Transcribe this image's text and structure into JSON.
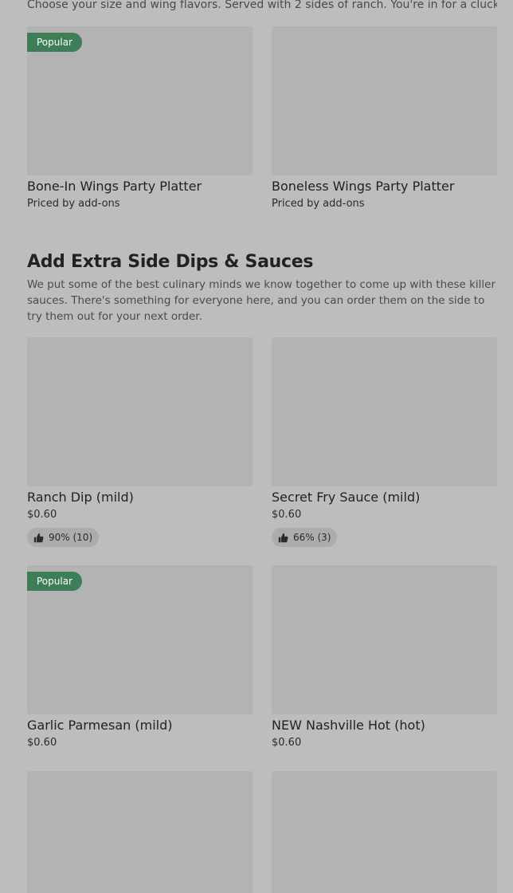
{
  "intro_text": "Choose your size and wing flavors. Served with 2 sides of ranch. You're in for a cluckin' treat!",
  "platters": [
    {
      "name": "Bone-In Wings Party Platter",
      "price": "Priced by add-ons",
      "badge": "Popular"
    },
    {
      "name": "Boneless Wings Party Platter",
      "price": "Priced by add-ons"
    }
  ],
  "section": {
    "title": "Add Extra Side Dips & Sauces",
    "description": "We put some of the best culinary minds we know together to come up with these killer sauces. There's something for everyone here, and you can order them on the side to try them out for your next order."
  },
  "sauces": [
    {
      "name": "Ranch Dip (mild)",
      "price": "$0.60",
      "rating": "90% (10)"
    },
    {
      "name": "Secret Fry Sauce (mild)",
      "price": "$0.60",
      "rating": "66% (3)"
    },
    {
      "name": "Garlic Parmesan (mild)",
      "price": "$0.60",
      "badge": "Popular"
    },
    {
      "name": "NEW Nashville Hot (hot)",
      "price": "$0.60"
    }
  ],
  "icons": {
    "rating": "thumbs-up-icon"
  },
  "colors": {
    "badge_bg": "#3e7e57",
    "placeholder": "#b3b3b3",
    "background": "#bdbdbd"
  }
}
